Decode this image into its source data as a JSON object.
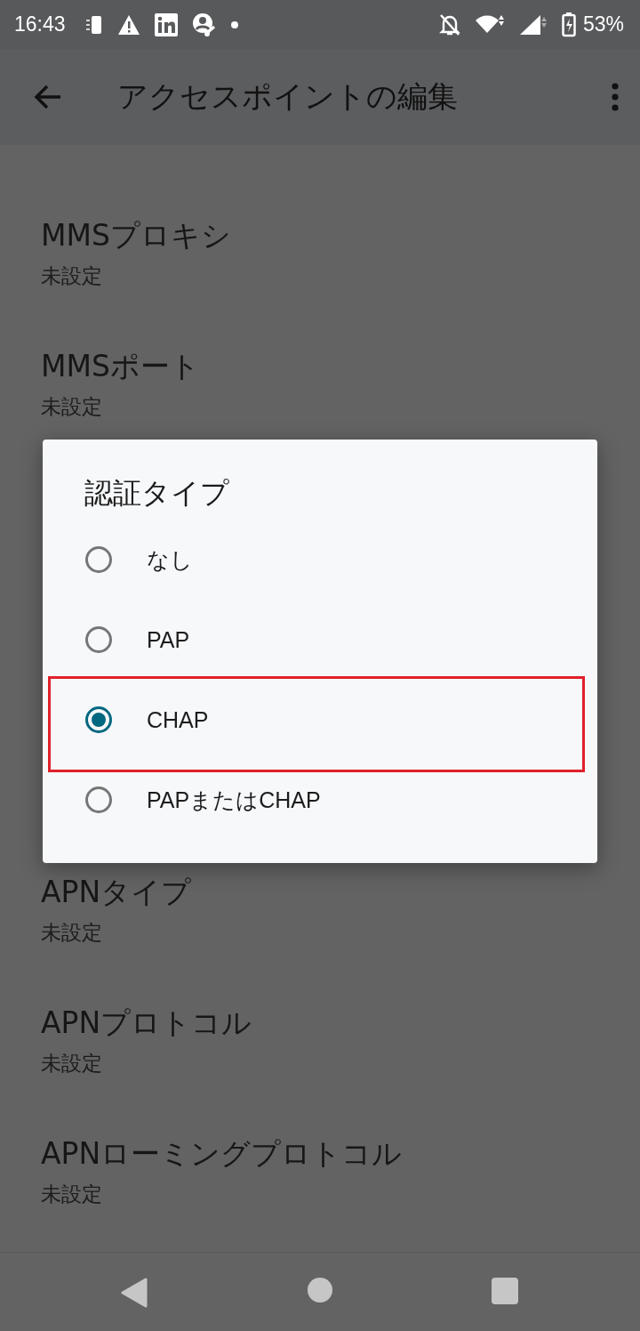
{
  "status_bar": {
    "time": "16:43",
    "battery": "53%"
  },
  "app_bar": {
    "title": "アクセスポイントの編集"
  },
  "list": {
    "items_above": [
      {
        "title": "MMSプロキシ",
        "summary": "未設定"
      },
      {
        "title": "MMSポート",
        "summary": "未設定"
      }
    ],
    "items_below": [
      {
        "title": "APNタイプ",
        "summary": "未設定"
      },
      {
        "title": "APNプロトコル",
        "summary": "未設定"
      },
      {
        "title": "APNローミングプロトコル",
        "summary": "未設定"
      }
    ]
  },
  "dialog": {
    "title": "認証タイプ",
    "options": [
      {
        "label": "なし",
        "selected": false,
        "highlighted": false
      },
      {
        "label": "PAP",
        "selected": false,
        "highlighted": false
      },
      {
        "label": "CHAP",
        "selected": true,
        "highlighted": true
      },
      {
        "label": "PAPまたはCHAP",
        "selected": false,
        "highlighted": false
      }
    ]
  }
}
